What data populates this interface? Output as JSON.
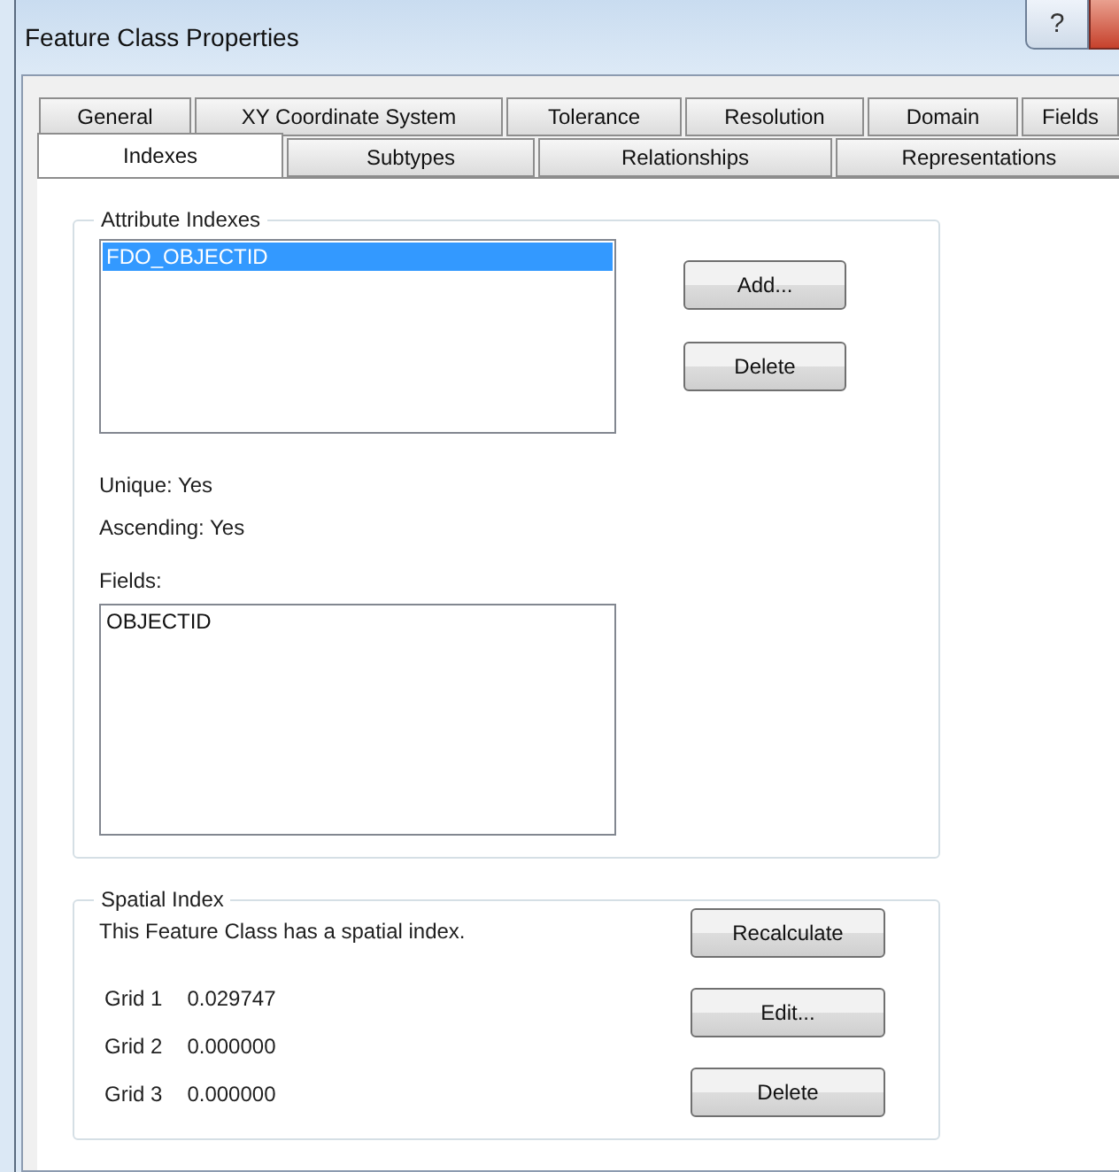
{
  "window": {
    "title": "Feature Class Properties",
    "help_button": "?"
  },
  "tabs": {
    "row_1": [
      {
        "label": "General",
        "selected": false
      },
      {
        "label": "XY Coordinate System",
        "selected": false
      },
      {
        "label": "Tolerance",
        "selected": false
      },
      {
        "label": "Resolution",
        "selected": false
      },
      {
        "label": "Domain",
        "selected": false
      },
      {
        "label": "Fields",
        "selected": false
      }
    ],
    "row_2": [
      {
        "label": "Indexes",
        "selected": true
      },
      {
        "label": "Subtypes",
        "selected": false
      },
      {
        "label": "Relationships",
        "selected": false
      },
      {
        "label": "Representations",
        "selected": false
      }
    ]
  },
  "attribute_indexes": {
    "title": "Attribute Indexes",
    "indexes": [
      {
        "label": "FDO_OBJECTID",
        "selected": true
      }
    ],
    "buttons": [
      "Add...",
      "Delete"
    ],
    "unique": "Unique: Yes",
    "ascending": "Ascending: Yes",
    "fields_label": "Fields:",
    "fields": [
      "OBJECTID"
    ]
  },
  "spatial_index": {
    "title": "Spatial Index",
    "status": "This Feature Class has a spatial index.",
    "grids": [
      {
        "label": "Grid 1",
        "value": "0.029747"
      },
      {
        "label": "Grid 2",
        "value": "0.000000"
      },
      {
        "label": "Grid 3",
        "value": "0.000000"
      }
    ],
    "buttons": [
      "Recalculate",
      "Edit...",
      "Delete"
    ]
  }
}
